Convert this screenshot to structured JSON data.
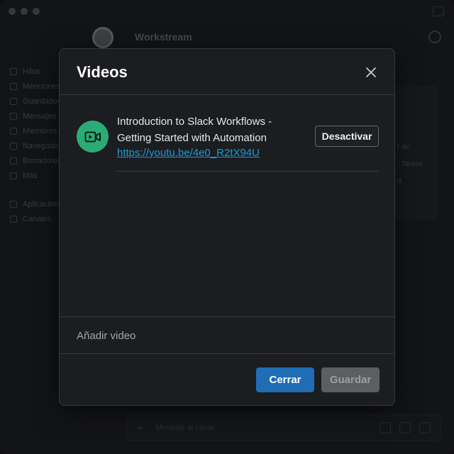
{
  "background": {
    "workspace_name": "Workstream",
    "sidebar_items": [
      "Hilos",
      "Menciones",
      "Guardados",
      "Mensajes",
      "Miembros",
      "Navegador",
      "Borradores",
      "Más",
      "Aplicaciones",
      "Canales"
    ],
    "side_text_1": "r de",
    "side_text_2": "- Tareas",
    "side_text_3": "d.",
    "composer_placeholder": "Mensaje al canal"
  },
  "modal": {
    "title": "Videos",
    "videos": [
      {
        "title": "Introduction to Slack Workflows - Getting Started with Automation",
        "url": "https://youtu.be/4e0_R2tX94U",
        "action_label": "Desactivar",
        "icon": "video-camera-icon",
        "icon_color": "#2bac76"
      }
    ],
    "add_video_label": "Añadir video",
    "footer": {
      "close_label": "Cerrar",
      "save_label": "Guardar"
    }
  },
  "colors": {
    "primary_button": "#1f6db5",
    "link": "#1d9bd1",
    "disabled_button": "#5c5e62",
    "modal_bg": "#1b1d21"
  }
}
